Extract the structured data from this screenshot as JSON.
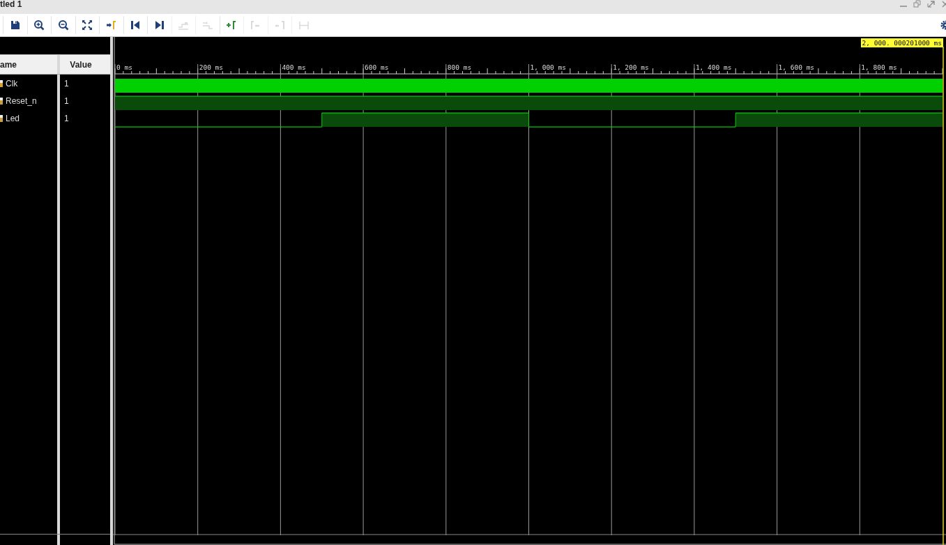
{
  "window": {
    "title": "tled 1",
    "controls": [
      {
        "kind": "minimize"
      },
      {
        "kind": "restore"
      },
      {
        "kind": "maximize"
      },
      {
        "kind": "close"
      }
    ]
  },
  "toolbar": {
    "tools": [
      {
        "kind": "save",
        "disabled": false
      },
      {
        "kind": "zoom-in",
        "disabled": false
      },
      {
        "kind": "zoom-out",
        "disabled": false
      },
      {
        "kind": "fit",
        "disabled": false
      },
      {
        "kind": "go-to-cursor",
        "disabled": false
      },
      {
        "kind": "prev-edge",
        "disabled": false
      },
      {
        "kind": "next-edge",
        "disabled": false
      },
      {
        "kind": "swap-left",
        "disabled": true
      },
      {
        "kind": "swap-right",
        "disabled": true
      },
      {
        "kind": "add-marker",
        "disabled": false
      },
      {
        "kind": "prev-marker",
        "disabled": true
      },
      {
        "kind": "next-marker",
        "disabled": true
      },
      {
        "kind": "span",
        "disabled": true
      }
    ]
  },
  "signals": {
    "columns": [
      "ame",
      "Value"
    ],
    "rows": [
      {
        "name": "Clk",
        "value": "1",
        "kind": "clock",
        "segments": [
          {
            "high": true
          }
        ]
      },
      {
        "name": "Reset_n",
        "value": "1",
        "kind": "logic",
        "segments": [
          {
            "high": true
          }
        ]
      },
      {
        "name": "Led",
        "value": "1",
        "kind": "logic",
        "segments": [
          {
            "high": false
          },
          {
            "high": true
          },
          {
            "high": false
          },
          {
            "high": true
          }
        ]
      }
    ]
  },
  "waveform": {
    "cursor": "2, 000. 000201000 ms",
    "ticks": [
      "0 ms",
      "200 ms",
      "400 ms",
      "600 ms",
      "800 ms",
      "1, 000 ms",
      "1, 200 ms",
      "1, 400 ms",
      "1, 600 ms",
      "1, 800 ms"
    ]
  }
}
